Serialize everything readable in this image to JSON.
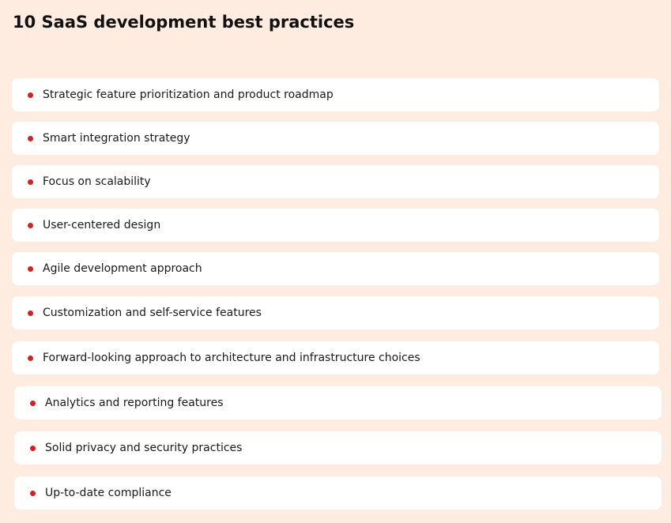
{
  "page": {
    "title": "10 SaaS development best practices"
  },
  "colors": {
    "background": "#fdecdf",
    "card": "#ffffff",
    "bullet": "#d42020",
    "text": "#1a1a1a"
  },
  "practices": [
    {
      "label": "Strategic feature prioritization and product roadmap"
    },
    {
      "label": "Smart integration strategy"
    },
    {
      "label": "Focus on scalability"
    },
    {
      "label": "User-centered design"
    },
    {
      "label": "Agile development approach"
    },
    {
      "label": "Customization and self-service features"
    },
    {
      "label": "Forward-looking approach to architecture and infrastructure choices"
    },
    {
      "label": "Analytics and reporting features"
    },
    {
      "label": "Solid privacy and security practices"
    },
    {
      "label": "Up-to-date compliance"
    }
  ]
}
